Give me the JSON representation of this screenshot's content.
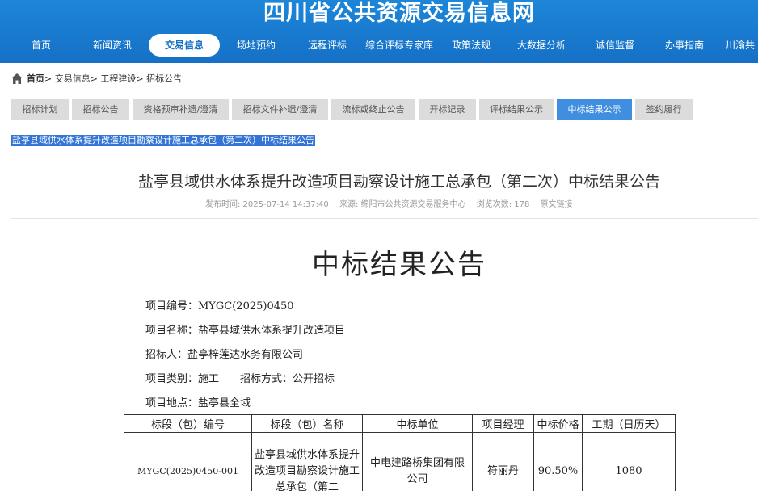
{
  "header": {
    "site_title": "四川省公共资源交易信息网",
    "nav": [
      "首页",
      "新闻资讯",
      "交易信息",
      "场地预约",
      "远程评标",
      "综合评标专家库",
      "政策法规",
      "大数据分析",
      "诚信监督",
      "办事指南",
      "川渝共"
    ],
    "active_nav": "交易信息"
  },
  "breadcrumb": {
    "home": "首页",
    "items": [
      "> 交易信息",
      "> 工程建设",
      "> 招标公告"
    ]
  },
  "tabs": [
    "招标计划",
    "招标公告",
    "资格预审补遗/澄清",
    "招标文件补遗/澄清",
    "流标或终止公告",
    "开标记录",
    "评标结果公示",
    "中标结果公示",
    "签约履行"
  ],
  "active_tab": "中标结果公示",
  "selected_title": "盐亭县域供水体系提升改造项目勘察设计施工总承包（第二次）中标结果公告",
  "article": {
    "title": "盐亭县域供水体系提升改造项目勘察设计施工总承包（第二次）中标结果公告",
    "meta": {
      "publish_time": "发布时间:  2025-07-14 14:37:40",
      "source": "来源:  绵阳市公共资源交易服务中心",
      "views": "浏览次数:  178",
      "original_link": "原文链接"
    },
    "doc_heading": "中标结果公告",
    "info": {
      "project_no": "项目编号：MYGC(2025)0450",
      "project_name": "项目名称：盐亭县域供水体系提升改造项目",
      "tenderer": "招标人：盐亭梓莲达水务有限公司",
      "project_type": "项目类别：施工",
      "tender_method": "招标方式：公开招标",
      "location": "项目地点：盐亭县全域"
    },
    "table": {
      "headers": [
        "标段（包）编号",
        "标段（包）名称",
        "中标单位",
        "项目经理",
        "中标价格",
        "工期（日历天）"
      ],
      "rows": [
        {
          "code": "MYGC(2025)0450-001",
          "name": "盐亭县域供水体系提升改造项目勘察设计施工总承包（第二",
          "winner": "中电建路桥集团有限公司",
          "manager": "符丽丹",
          "price": "90.50%",
          "period": "1080"
        }
      ]
    }
  }
}
